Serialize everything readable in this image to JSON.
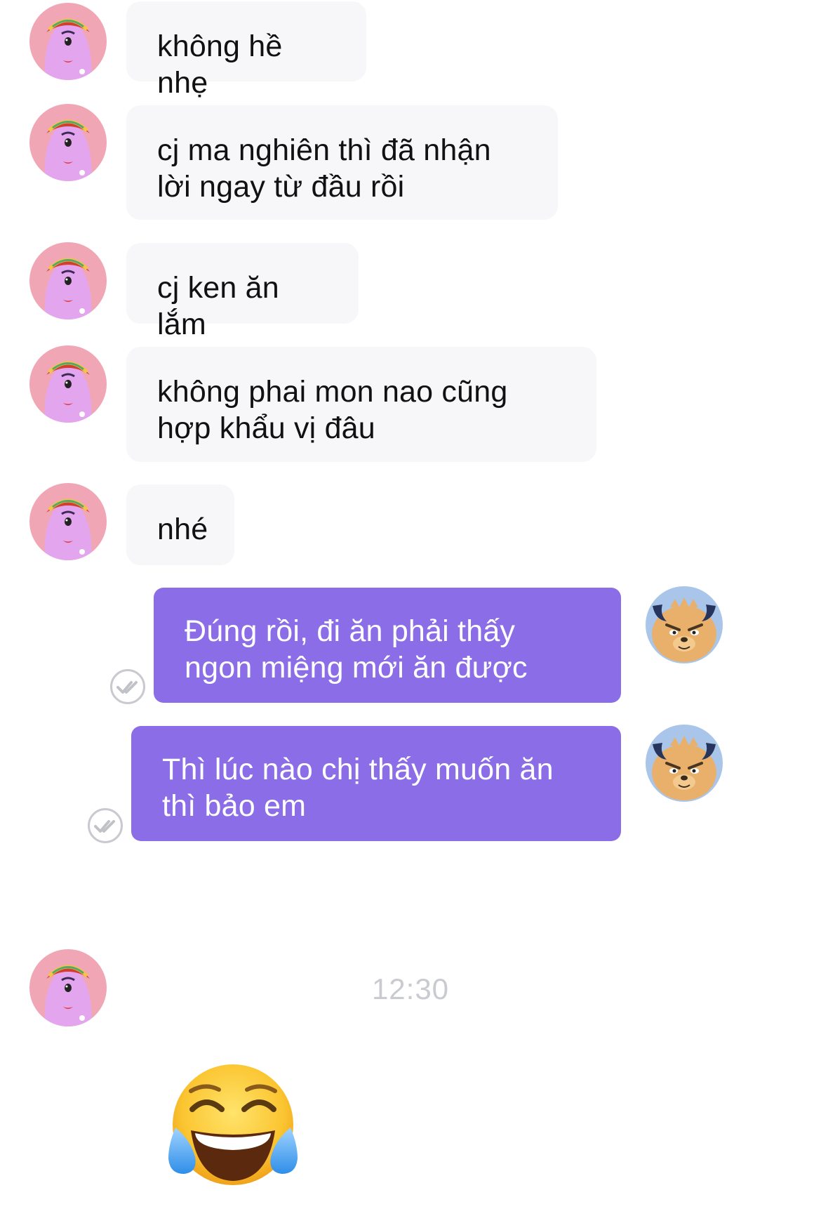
{
  "conversation": {
    "messages": [
      {
        "sender": "them",
        "text": "không hề nhẹ",
        "avatar_icon": "pink-one-eyed-monster-avatar"
      },
      {
        "sender": "them",
        "text": "cj ma nghiên thì đã nhận lời ngay từ đầu rồi",
        "avatar_icon": "pink-one-eyed-monster-avatar"
      },
      {
        "sender": "them",
        "text": "cj ken ăn lắm",
        "avatar_icon": "pink-one-eyed-monster-avatar"
      },
      {
        "sender": "them",
        "text": "không phai mon nao cũng hợp khẩu vị đâu",
        "avatar_icon": "pink-one-eyed-monster-avatar"
      },
      {
        "sender": "them",
        "text": "nhé",
        "avatar_icon": "pink-one-eyed-monster-avatar"
      },
      {
        "sender": "me",
        "text": "Đúng rồi, đi ăn phải thấy ngon miệng mới ăn được",
        "avatar_icon": "horned-bull-avatar",
        "status_icon": "seen-double-check-icon"
      },
      {
        "sender": "me",
        "text": "Thì lúc nào chị thấy muốn ăn thì bảo em",
        "avatar_icon": "horned-bull-avatar",
        "status_icon": "seen-double-check-icon"
      }
    ],
    "timestamp": "12:30",
    "last_message": {
      "sender": "them",
      "type": "sticker",
      "sticker_icon": "tears-of-joy-emoji-icon",
      "avatar_icon": "pink-one-eyed-monster-avatar"
    }
  },
  "colors": {
    "incoming_bubble": "#f7f7f9",
    "outgoing_bubble": "#8b6ee7",
    "timestamp_text": "#c9cbd1"
  }
}
